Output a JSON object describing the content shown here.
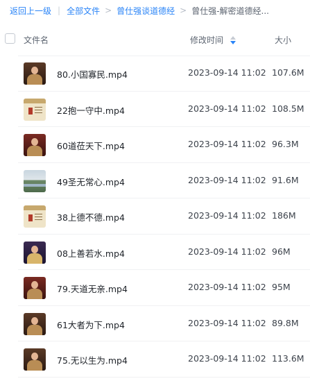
{
  "breadcrumb": {
    "back": "返回上一级",
    "root": "全部文件",
    "parent": "曾仕强谈道德经",
    "current": "曾仕强-解密道德经..."
  },
  "table": {
    "col_name": "文件名",
    "col_time": "修改时间",
    "col_size": "大小",
    "sort_icon": "sort-desc-icon"
  },
  "files": [
    {
      "name": "80.小国寡民.mp4",
      "time": "2023-09-14 11:02",
      "size": "107.6M",
      "thumb": "video-thumbnail-person"
    },
    {
      "name": "22抱一守中.mp4",
      "time": "2023-09-14 11:02",
      "size": "108.5M",
      "thumb": "video-thumbnail-calligraphy"
    },
    {
      "name": "60道莅天下.mp4",
      "time": "2023-09-14 11:02",
      "size": "96.3M",
      "thumb": "video-thumbnail-person"
    },
    {
      "name": "49圣无常心.mp4",
      "time": "2023-09-14 11:02",
      "size": "91.6M",
      "thumb": "video-thumbnail-landscape"
    },
    {
      "name": "38上德不德.mp4",
      "time": "2023-09-14 11:02",
      "size": "186M",
      "thumb": "video-thumbnail-calligraphy"
    },
    {
      "name": "08上善若水.mp4",
      "time": "2023-09-14 11:02",
      "size": "96M",
      "thumb": "video-thumbnail-person"
    },
    {
      "name": "79.天道无亲.mp4",
      "time": "2023-09-14 11:02",
      "size": "95M",
      "thumb": "video-thumbnail-person"
    },
    {
      "name": "61大者为下.mp4",
      "time": "2023-09-14 11:02",
      "size": "89.8M",
      "thumb": "video-thumbnail-person"
    },
    {
      "name": "75.无以生为.mp4",
      "time": "2023-09-14 11:02",
      "size": "113.6M",
      "thumb": "video-thumbnail-person"
    }
  ]
}
